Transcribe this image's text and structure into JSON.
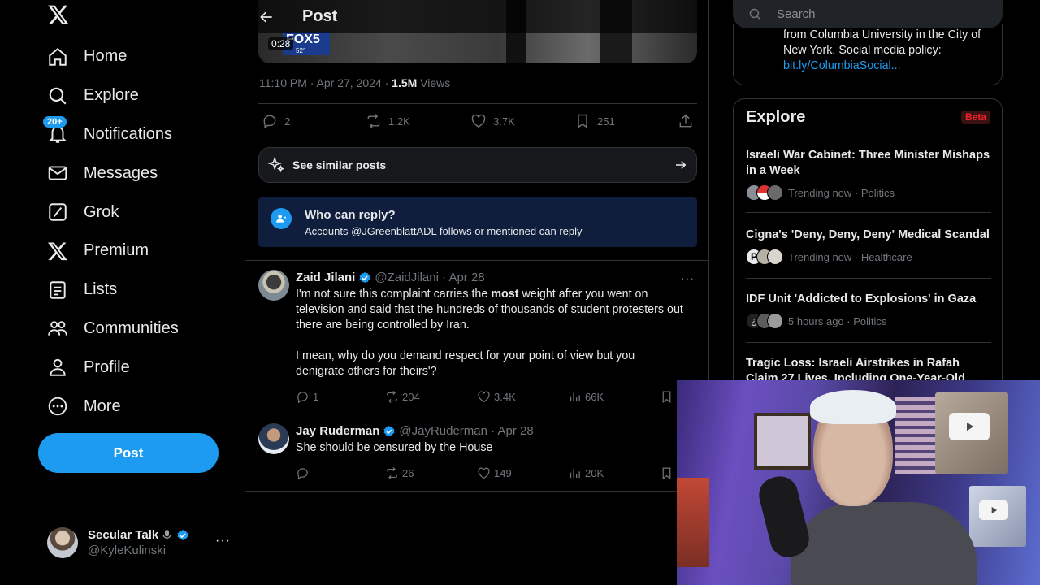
{
  "sidebar": {
    "nav": [
      {
        "label": "Home",
        "icon": "home-icon"
      },
      {
        "label": "Explore",
        "icon": "search-icon"
      },
      {
        "label": "Notifications",
        "icon": "bell-icon",
        "badge": "20+"
      },
      {
        "label": "Messages",
        "icon": "envelope-icon"
      },
      {
        "label": "Grok",
        "icon": "grok-icon"
      },
      {
        "label": "Premium",
        "icon": "x-logo-icon"
      },
      {
        "label": "Lists",
        "icon": "list-icon"
      },
      {
        "label": "Communities",
        "icon": "people-icon"
      },
      {
        "label": "Profile",
        "icon": "person-icon"
      },
      {
        "label": "More",
        "icon": "more-circle-icon"
      }
    ],
    "post_button": "Post",
    "account": {
      "name": "Secular Talk",
      "handle": "@KyleKulinski",
      "more": "···"
    }
  },
  "main": {
    "header_title": "Post",
    "video": {
      "duration": "0:28",
      "channel_logo": "FOX5",
      "weather": "52°"
    },
    "timestamp": "11:10 PM · Apr 27, 2024 · ",
    "views_count": "1.5M",
    "views_label": " Views",
    "actions": {
      "replies": "2",
      "reposts": "1.2K",
      "likes": "3.7K",
      "bookmarks": "251"
    },
    "similar_posts": "See similar posts",
    "who_can_reply": {
      "title": "Who can reply?",
      "text": "Accounts @JGreenblattADL follows or mentioned can reply"
    },
    "replies": [
      {
        "name": "Zaid Jilani",
        "handle": "@ZaidJilani · Apr 28",
        "text_before": "I'm not sure this complaint carries the ",
        "text_bold": "most",
        "text_after": " weight after you went on television and said that the hundreds of thousands of student protesters out there are being controlled by Iran.",
        "text_p2": "I mean, why do you demand respect for your point of view but you denigrate others for theirs'?",
        "replies": "1",
        "reposts": "204",
        "likes": "3.4K",
        "views": "66K"
      },
      {
        "name": "Jay Ruderman",
        "handle": "@JayRuderman · Apr 28",
        "text": "She should be censured by the House",
        "replies": "",
        "reposts": "26",
        "likes": "149",
        "views": "20K"
      }
    ]
  },
  "right": {
    "search_placeholder": "Search",
    "bio": {
      "text": "from Columbia University in the City of New York. Social media policy:",
      "link": "bit.ly/ColumbiaSocial..."
    },
    "explore": {
      "title": "Explore",
      "badge": "Beta",
      "trends": [
        {
          "title": "Israeli War Cabinet: Three Minister Mishaps in a Week",
          "meta": "Trending now · Politics"
        },
        {
          "title": "Cigna's 'Deny, Deny, Deny' Medical Scandal",
          "meta": "Trending now · Healthcare"
        },
        {
          "title": "IDF Unit 'Addicted to Explosions' in Gaza",
          "meta": "5 hours ago · Politics"
        },
        {
          "title": "Tragic Loss: Israeli Airstrikes in Rafah Claim 27 Lives, Including One-Year-Old",
          "meta": ""
        }
      ]
    }
  },
  "colors": {
    "accent": "#1d9bf0",
    "background": "#000000",
    "border": "#2f3336",
    "muted": "#71767b"
  }
}
